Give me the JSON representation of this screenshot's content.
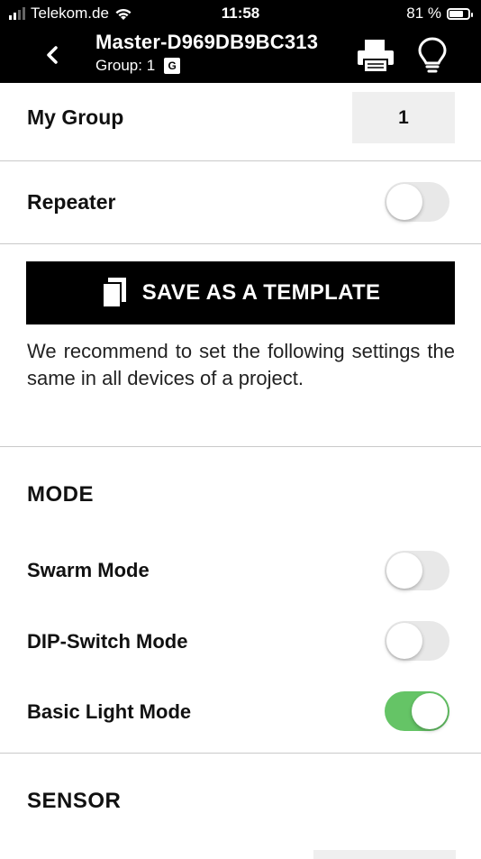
{
  "status_bar": {
    "carrier": "Telekom.de",
    "time": "11:58",
    "battery_percent": "81 %",
    "icons": [
      "signal-icon",
      "wifi-icon",
      "battery-icon"
    ]
  },
  "header": {
    "title": "Master-D969DB9BC313",
    "group_label": "Group: 1",
    "group_badge": "G",
    "icons": [
      "back-chevron-icon",
      "printer-icon",
      "lightbulb-icon"
    ]
  },
  "my_group": {
    "label": "My Group",
    "value": "1"
  },
  "repeater": {
    "label": "Repeater",
    "enabled": false
  },
  "template": {
    "button_label": "SAVE AS A TEMPLATE",
    "icon": "copy-icon",
    "note": "We recommend to set the following settings the same in all devices of a project."
  },
  "mode": {
    "title": "MODE",
    "items": [
      {
        "label": "Swarm Mode",
        "enabled": false
      },
      {
        "label": "DIP-Switch Mode",
        "enabled": false
      },
      {
        "label": "Basic Light Mode",
        "enabled": true
      }
    ]
  },
  "sensor": {
    "title": "SENSOR"
  },
  "colors": {
    "header_bg": "#000000",
    "toggle_on": "#65c466",
    "toggle_off": "#e8e8e8",
    "value_box_bg": "#efefef"
  }
}
